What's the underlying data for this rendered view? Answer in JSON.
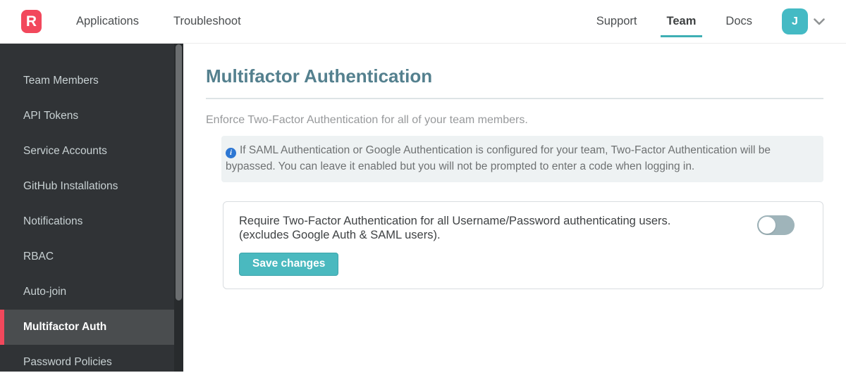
{
  "header": {
    "logo_letter": "R",
    "nav_left": [
      {
        "label": "Applications"
      },
      {
        "label": "Troubleshoot"
      }
    ],
    "nav_right": [
      {
        "label": "Support"
      },
      {
        "label": "Team",
        "active": true
      },
      {
        "label": "Docs"
      }
    ],
    "avatar_initial": "J",
    "chevron_icon": "chevron-down"
  },
  "sidebar": {
    "items": [
      {
        "label": "Team Members"
      },
      {
        "label": "API Tokens"
      },
      {
        "label": "Service Accounts"
      },
      {
        "label": "GitHub Installations"
      },
      {
        "label": "Notifications"
      },
      {
        "label": "RBAC"
      },
      {
        "label": "Auto-join"
      },
      {
        "label": "Multifactor Auth",
        "active": true
      },
      {
        "label": "Password Policies"
      }
    ]
  },
  "main": {
    "title": "Multifactor Authentication",
    "subtitle": "Enforce Two-Factor Authentication for all of your team members.",
    "info_icon": "i",
    "info_note": "If SAML Authentication or Google Authentication is configured for your team, Two-Factor Authentication will be bypassed. You can leave it enabled but you will not be prompted to enter a code when logging in.",
    "setting": {
      "label_line1": "Require Two-Factor Authentication for all Username/Password authenticating users.",
      "label_line2": "(excludes Google Auth & SAML users).",
      "toggle_state": "off",
      "save_button": "Save changes"
    }
  },
  "colors": {
    "brand_red": "#f2485c",
    "teal_accent": "#45b8bf",
    "heading_teal": "#54808e",
    "info_icon_blue": "#2d77d3",
    "sidebar_bg": "#303336"
  }
}
